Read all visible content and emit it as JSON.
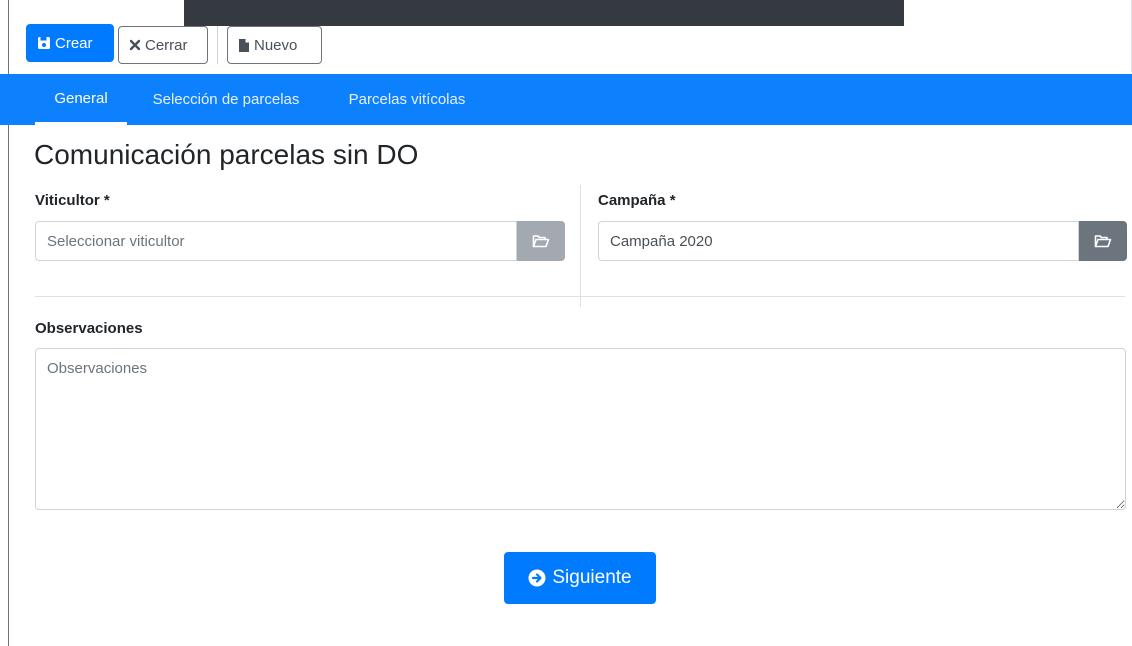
{
  "toolbar": {
    "crear_label": "Crear",
    "cerrar_label": "Cerrar",
    "nuevo_label": "Nuevo"
  },
  "tabs": [
    {
      "label": "General",
      "active": true
    },
    {
      "label": "Selección de parcelas",
      "active": false
    },
    {
      "label": "Parcelas vitícolas",
      "active": false
    }
  ],
  "page": {
    "title": "Comunicación parcelas sin DO"
  },
  "form": {
    "viticultor": {
      "label": "Viticultor *",
      "value": "",
      "placeholder": "Seleccionar viticultor"
    },
    "campana": {
      "label": "Campaña *",
      "value": "Campaña 2020",
      "placeholder": ""
    },
    "observaciones": {
      "label": "Observaciones",
      "value": "",
      "placeholder": "Observaciones"
    },
    "siguiente_label": "Siguiente"
  },
  "colors": {
    "primary": "#007bff",
    "tabbar": "#0d80fe",
    "addon_dark": "#6c757d",
    "addon_light": "#a2a9b1"
  },
  "icons": {
    "crear": "save-icon",
    "cerrar": "close-icon",
    "nuevo": "file-icon",
    "viticultor_addon": "folder-open-icon",
    "campana_addon": "folder-open-icon",
    "siguiente": "arrow-circle-right-icon"
  }
}
